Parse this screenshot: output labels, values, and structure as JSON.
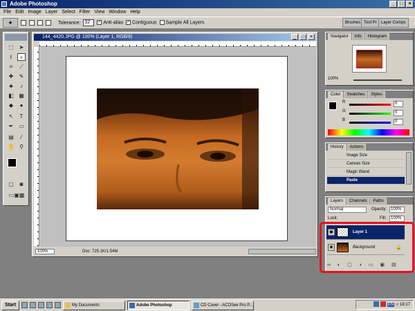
{
  "app": {
    "title": "Adobe Photoshop"
  },
  "menu": [
    "File",
    "Edit",
    "Image",
    "Layer",
    "Select",
    "Filter",
    "View",
    "Window",
    "Help"
  ],
  "options": {
    "tolerance_label": "Tolerance:",
    "tolerance_value": "32",
    "anti_alias": "Anti-alias",
    "contiguous": "Contiguous",
    "sample_all": "Sample All Layers"
  },
  "palette_well": [
    "Brushes",
    "Tool Pr",
    "Layer Comps"
  ],
  "document": {
    "title": "144_4420.JPG @ 100% (Layer 1, RGB/8)",
    "zoom": "100%",
    "doc_info": "Doc: 725.1K/1.54M"
  },
  "navigator": {
    "tabs": [
      "Navigator",
      "Info",
      "Histogram"
    ],
    "zoom": "100%"
  },
  "color": {
    "tabs": [
      "Color",
      "Swatches",
      "Styles"
    ],
    "r": "0",
    "g": "0",
    "b": "0",
    "r_label": "R",
    "g_label": "G",
    "b_label": "B"
  },
  "history": {
    "tabs": [
      "History",
      "Actions"
    ],
    "items": [
      "Image Size",
      "Canvas Size",
      "Magic Wand",
      "Paste"
    ]
  },
  "layers": {
    "tabs": [
      "Layers",
      "Channels",
      "Paths"
    ],
    "blend": "Normal",
    "opacity_label": "Opacity:",
    "opacity": "100%",
    "lock_label": "Lock:",
    "fill_label": "Fill:",
    "fill": "100%",
    "items": [
      "Layer 1",
      "Background"
    ]
  },
  "taskbar": {
    "start": "Start",
    "tasks": [
      "My Documents",
      "Adobe Photoshop",
      "CD Cover - ACDSee Pro P..."
    ],
    "lang": "EN",
    "clock": "18:17"
  },
  "colors": {
    "highlight": "#e81020",
    "selection": "#0a246a"
  }
}
